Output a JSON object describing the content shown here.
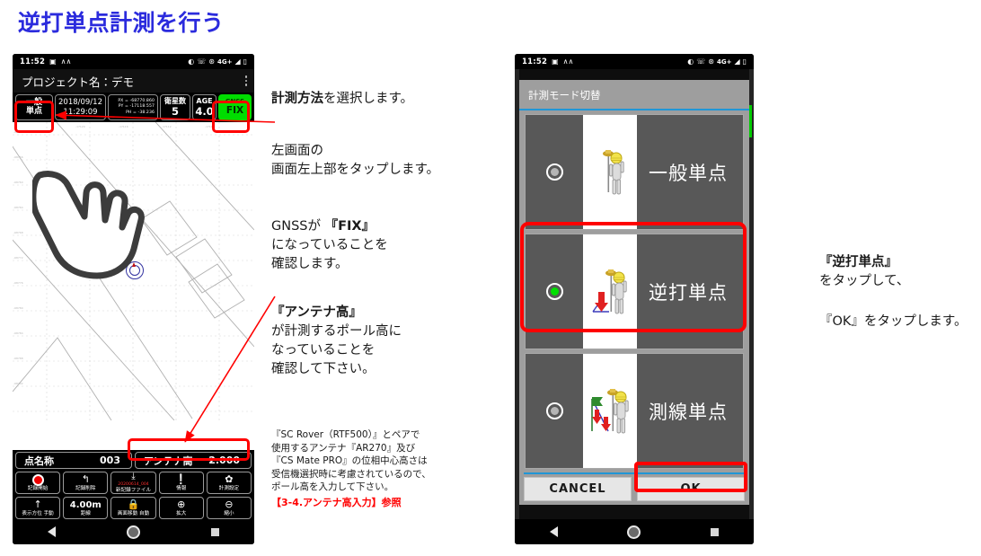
{
  "page": {
    "title": "逆打単点計測を行う"
  },
  "left_phone": {
    "statusbar": {
      "clock": "11:52",
      "left_icons": [
        "sd-card-icon",
        "monochrome-icon"
      ],
      "right_icons": [
        "brightness-icon",
        "call-icon",
        "alarm-icon",
        "battery-icon"
      ],
      "network": "4G+"
    },
    "app": {
      "title": "プロジェクト名：デモ",
      "menu_icon": "overflow-menu-icon",
      "infobar": {
        "mode_label": "一般\n単点",
        "date": "2018/09/12",
        "time": "11:29:09",
        "px": "PX = -68770.860",
        "py": "PY = -17118.557",
        "ph": "PH = -38.236",
        "sat_label": "衛星数",
        "sat_value": "5",
        "age_label": "AGE",
        "age_value": "4.0",
        "gnss_label": "GNSS",
        "gnss_value": "FIX",
        "gnss_color": "#00dd00"
      },
      "bottom": {
        "point_name_label": "点名称",
        "point_name_value": "003",
        "antenna_label": "アンテナ高",
        "antenna_value": "2.000",
        "buttons_row1": [
          {
            "icon": "record-dot-icon",
            "label": "記録開始"
          },
          {
            "icon": "undo-arrow-icon",
            "label": "記録削除"
          },
          {
            "icon": "save-file-icon",
            "label": "新記録ファイル",
            "sub": "20200614_004"
          },
          {
            "icon": "info-icon",
            "label": "情報"
          },
          {
            "icon": "gear-icon",
            "label": "計測設定"
          }
        ],
        "buttons_row2": [
          {
            "icon": "up-arrow-icon",
            "label": "表示方位 手動"
          },
          {
            "icon": "",
            "value": "4.00m",
            "label": "距線"
          },
          {
            "icon": "lock-icon",
            "label": "画面移動 自動"
          },
          {
            "icon": "zoom-in-icon",
            "label": "拡大"
          },
          {
            "icon": "zoom-out-icon",
            "label": "縮小"
          }
        ]
      }
    },
    "navbar": [
      "back-icon",
      "home-icon",
      "recents-icon"
    ]
  },
  "right_phone": {
    "statusbar": {
      "clock": "11:52",
      "network": "4G+"
    },
    "dialog": {
      "title": "計測モード切替",
      "options": [
        {
          "label": "一般単点",
          "selected": false,
          "icon": "surveyor-general-icon"
        },
        {
          "label": "逆打単点",
          "selected": true,
          "icon": "surveyor-stakeout-icon"
        },
        {
          "label": "測線単点",
          "selected": false,
          "icon": "surveyor-line-icon"
        }
      ],
      "cancel_label": "CANCEL",
      "ok_label": "OK"
    },
    "navbar": [
      "back-icon",
      "home-icon",
      "recents-icon"
    ]
  },
  "annotations": {
    "center": {
      "line1_bold": "計測方法",
      "line1_rest": "を選択します。",
      "block2": "左画面の\n画面左上部をタップします。",
      "block3_pre": "GNSSが ",
      "block3_bold": "『FIX』",
      "block3_rest": "\nになっていることを\n確認します。",
      "block4_bold": "『アンテナ高』",
      "block4_rest": "\nが計測するポール高に\nなっていることを\n確認して下さい。",
      "small_note": "『SC Rover（RTF500）』とペアで\n使用するアンテナ『AR270』及び\n『CS Mate PRO』の位相中心高さは\n受信機選択時に考慮されているので、\nポール高を入力して下さい。",
      "reference": "【3-4.アンテナ高入力】参照"
    },
    "right": {
      "bold": "『逆打単点』",
      "rest": "をタップして、",
      "second": "『OK』をタップします。"
    }
  },
  "colors": {
    "title_blue": "#2b2bdd",
    "highlight_red": "#ff0000",
    "gnss_green": "#00dd00",
    "radio_green": "#00e000",
    "dialog_blue_rule": "#2196d6"
  }
}
